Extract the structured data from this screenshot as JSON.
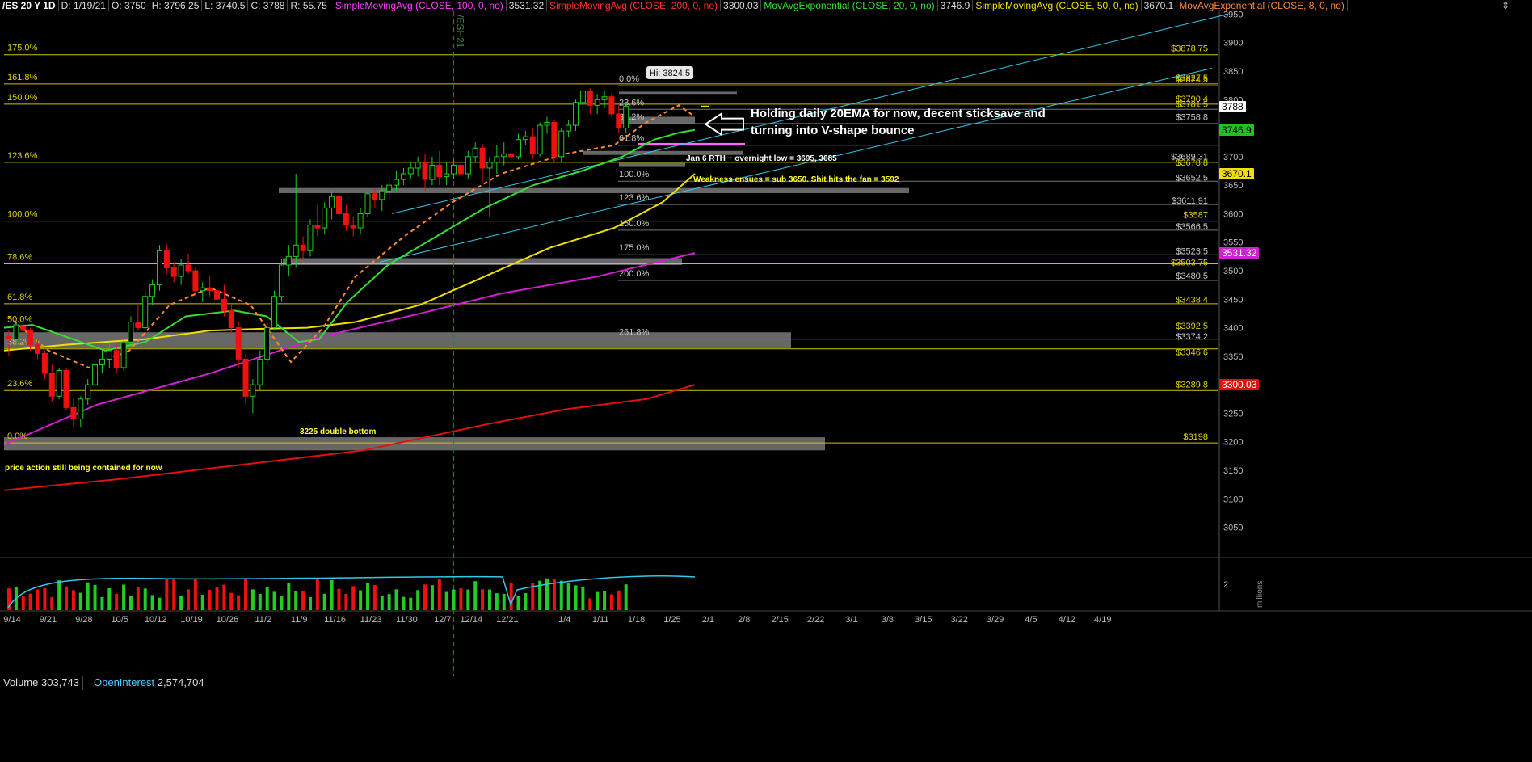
{
  "header": {
    "symbol": "/ES 20 Y 1D",
    "date": "D: 1/19/21",
    "open": "O: 3750",
    "high": "H: 3796.25",
    "low": "L: 3740.5",
    "close": "C: 3788",
    "range": "R: 55.75",
    "studies": [
      {
        "label": "SimpleMovingAvg (CLOSE, 100, 0, no)",
        "value": "3531.32",
        "color": "#ff3cff"
      },
      {
        "label": "SimpleMovingAvg (CLOSE, 200, 0, no)",
        "value": "3300.03",
        "color": "#ff3030"
      },
      {
        "label": "MovAvgExponential (CLOSE, 20, 0, no)",
        "value": "3746.9",
        "color": "#33e033"
      },
      {
        "label": "SimpleMovingAvg (CLOSE, 50, 0, no)",
        "value": "3670.1",
        "color": "#f0e000"
      },
      {
        "label": "MovAvgExponential (CLOSE, 8, 0, no)",
        "value": "",
        "color": "#ff8833"
      }
    ]
  },
  "chart_data": {
    "type": "candlestick",
    "price_axis": {
      "min": 3000,
      "max": 3950,
      "ticks": [
        3050,
        3100,
        3150,
        3200,
        3250,
        3300,
        3350,
        3400,
        3450,
        3500,
        3550,
        3600,
        3650,
        3700,
        3750,
        3800,
        3850,
        3900,
        3950
      ]
    },
    "date_labels": [
      "9/14",
      "9/21",
      "9/28",
      "10/5",
      "10/12",
      "10/19",
      "10/26",
      "11/2",
      "11/9",
      "11/16",
      "11/23",
      "11/30",
      "12/7",
      "12/14",
      "12/21",
      "1/4",
      "1/11",
      "1/18",
      "1/25",
      "2/1",
      "2/8",
      "2/15",
      "2/22",
      "3/1",
      "3/8",
      "3/15",
      "3/22",
      "3/29",
      "4/5",
      "4/12",
      "4/19"
    ],
    "date_label_index": [
      0,
      5,
      10,
      15,
      20,
      25,
      30,
      35,
      40,
      45,
      50,
      55,
      60,
      64,
      69,
      77,
      82,
      87,
      92,
      97,
      102,
      107,
      112,
      117,
      122,
      127,
      132,
      137,
      142,
      147,
      152
    ],
    "expiry_marker": {
      "label": "/ESH21",
      "index": 62
    },
    "ohlc": [
      [
        3385,
        3395,
        3350,
        3380
      ],
      [
        3380,
        3410,
        3370,
        3405
      ],
      [
        3402,
        3415,
        3390,
        3395
      ],
      [
        3395,
        3400,
        3360,
        3370
      ],
      [
        3370,
        3380,
        3345,
        3355
      ],
      [
        3355,
        3360,
        3310,
        3320
      ],
      [
        3320,
        3335,
        3270,
        3280
      ],
      [
        3280,
        3330,
        3275,
        3325
      ],
      [
        3325,
        3330,
        3255,
        3260
      ],
      [
        3260,
        3275,
        3225,
        3240
      ],
      [
        3240,
        3280,
        3225,
        3275
      ],
      [
        3275,
        3310,
        3265,
        3300
      ],
      [
        3300,
        3340,
        3290,
        3335
      ],
      [
        3335,
        3360,
        3320,
        3345
      ],
      [
        3345,
        3375,
        3330,
        3360
      ],
      [
        3360,
        3370,
        3320,
        3330
      ],
      [
        3330,
        3380,
        3325,
        3375
      ],
      [
        3375,
        3420,
        3365,
        3410
      ],
      [
        3410,
        3440,
        3395,
        3400
      ],
      [
        3400,
        3465,
        3395,
        3455
      ],
      [
        3455,
        3485,
        3440,
        3475
      ],
      [
        3475,
        3545,
        3465,
        3535
      ],
      [
        3535,
        3545,
        3495,
        3505
      ],
      [
        3505,
        3515,
        3480,
        3490
      ],
      [
        3490,
        3520,
        3475,
        3510
      ],
      [
        3510,
        3530,
        3495,
        3500
      ],
      [
        3500,
        3505,
        3455,
        3465
      ],
      [
        3465,
        3480,
        3445,
        3470
      ],
      [
        3470,
        3490,
        3455,
        3465
      ],
      [
        3465,
        3480,
        3440,
        3450
      ],
      [
        3450,
        3475,
        3420,
        3430
      ],
      [
        3430,
        3440,
        3390,
        3400
      ],
      [
        3400,
        3410,
        3330,
        3345
      ],
      [
        3345,
        3355,
        3265,
        3280
      ],
      [
        3280,
        3310,
        3250,
        3300
      ],
      [
        3300,
        3360,
        3290,
        3345
      ],
      [
        3345,
        3410,
        3335,
        3400
      ],
      [
        3400,
        3465,
        3395,
        3455
      ],
      [
        3455,
        3520,
        3445,
        3510
      ],
      [
        3510,
        3545,
        3490,
        3525
      ],
      [
        3525,
        3670,
        3505,
        3545
      ],
      [
        3545,
        3560,
        3520,
        3535
      ],
      [
        3535,
        3590,
        3525,
        3580
      ],
      [
        3580,
        3615,
        3560,
        3575
      ],
      [
        3575,
        3620,
        3565,
        3610
      ],
      [
        3610,
        3640,
        3590,
        3630
      ],
      [
        3630,
        3640,
        3590,
        3600
      ],
      [
        3600,
        3615,
        3570,
        3580
      ],
      [
        3580,
        3595,
        3560,
        3575
      ],
      [
        3575,
        3610,
        3565,
        3600
      ],
      [
        3600,
        3640,
        3595,
        3635
      ],
      [
        3635,
        3645,
        3610,
        3625
      ],
      [
        3625,
        3650,
        3605,
        3640
      ],
      [
        3640,
        3665,
        3625,
        3650
      ],
      [
        3650,
        3675,
        3640,
        3660
      ],
      [
        3660,
        3680,
        3650,
        3670
      ],
      [
        3670,
        3690,
        3660,
        3680
      ],
      [
        3680,
        3700,
        3665,
        3690
      ],
      [
        3690,
        3705,
        3640,
        3660
      ],
      [
        3660,
        3700,
        3650,
        3685
      ],
      [
        3685,
        3710,
        3650,
        3665
      ],
      [
        3665,
        3690,
        3650,
        3670
      ],
      [
        3670,
        3695,
        3660,
        3685
      ],
      [
        3685,
        3700,
        3660,
        3670
      ],
      [
        3670,
        3710,
        3660,
        3700
      ],
      [
        3700,
        3725,
        3690,
        3715
      ],
      [
        3715,
        3722,
        3655,
        3680
      ],
      [
        3680,
        3700,
        3595,
        3690
      ],
      [
        3690,
        3720,
        3670,
        3700
      ],
      [
        3700,
        3725,
        3685,
        3705
      ],
      [
        3705,
        3725,
        3690,
        3700
      ],
      [
        3700,
        3740,
        3695,
        3730
      ],
      [
        3730,
        3745,
        3720,
        3735
      ],
      [
        3735,
        3750,
        3695,
        3705
      ],
      [
        3705,
        3760,
        3700,
        3755
      ],
      [
        3755,
        3770,
        3740,
        3760
      ],
      [
        3760,
        3765,
        3690,
        3700
      ],
      [
        3700,
        3750,
        3690,
        3745
      ],
      [
        3745,
        3765,
        3735,
        3755
      ],
      [
        3755,
        3800,
        3745,
        3795
      ],
      [
        3795,
        3824.5,
        3780,
        3815
      ],
      [
        3815,
        3820,
        3775,
        3790
      ],
      [
        3790,
        3810,
        3775,
        3800
      ],
      [
        3800,
        3815,
        3785,
        3805
      ],
      [
        3805,
        3810,
        3770,
        3775
      ],
      [
        3775,
        3790,
        3740,
        3750
      ],
      [
        3750,
        3796.25,
        3740.5,
        3788
      ]
    ],
    "annotations": [
      {
        "text": "Holding daily 20EMA for now, decent sticksave and",
        "color": "#ffffff",
        "size": "large"
      },
      {
        "text": "turning into V-shape bounce",
        "color": "#ffffff",
        "size": "large"
      },
      {
        "text": "Jan 6  RTH + overnight low = 3695, 3685",
        "color": "#ffffff",
        "size": "small"
      },
      {
        "text": "Weakness ensues = sub 3650. Shit hits the fan = 3592",
        "color": "#ffff33",
        "size": "small"
      },
      {
        "text": "3225 double bottom",
        "color": "#ffff33",
        "size": "small"
      },
      {
        "text": "price action still being contained for now",
        "color": "#ffff33",
        "size": "small"
      }
    ],
    "high_marker": {
      "text": "Hi: 3824.5",
      "price": 3824.5
    },
    "left_fib_labels": [
      "175.0%",
      "161.8%",
      "150.0%",
      "123.6%",
      "100.0%",
      "78.6%",
      "61.8%",
      "50.0%",
      "38.2%",
      "23.6%",
      "0.0%"
    ],
    "left_fib_prices": [
      3878.75,
      3827.5,
      3792,
      3690,
      3587,
      3512,
      3442,
      3403,
      3363,
      3290,
      3198
    ],
    "inner_fib_labels": [
      "0.0%",
      "23.6%",
      "38.2%",
      "61.8%",
      "100.0%",
      "123.6%",
      "150.0%",
      "175.0%",
      "200.0%",
      "261.8%"
    ],
    "inner_fib_prices": [
      3824.5,
      3783,
      3758,
      3720,
      3657,
      3616,
      3571,
      3528,
      3483,
      3380
    ],
    "level_labels": [
      "$3878.75",
      "$3827.5",
      "$3824.5",
      "$3790.4",
      "$3781.5",
      "$3758.8",
      "$3689.31",
      "$3678.8",
      "$3652.5",
      "$3611.91",
      "$3587",
      "$3566.5",
      "$3523.5",
      "$3503.75",
      "$3480.5",
      "$3438.4",
      "$3392.5",
      "$3374.2",
      "$3346.6",
      "$3289.8",
      "$3198"
    ],
    "level_prices": [
      3878.75,
      3827.5,
      3824.5,
      3790.4,
      3781.5,
      3758.8,
      3689.31,
      3678.8,
      3652.5,
      3611.91,
      3587,
      3566.5,
      3523.5,
      3503.75,
      3480.5,
      3438.4,
      3392.5,
      3374.2,
      3346.6,
      3289.8,
      3198
    ],
    "price_tags": [
      {
        "text": "3788",
        "price": 3788,
        "bg": "#ffffff",
        "fg": "#000000"
      },
      {
        "text": "3746.9",
        "price": 3746.9,
        "bg": "#22c022",
        "fg": "#000000"
      },
      {
        "text": "3670.1",
        "price": 3670.1,
        "bg": "#f0e000",
        "fg": "#000000"
      },
      {
        "text": "3531.32",
        "price": 3531.32,
        "bg": "#d020d0",
        "fg": "#ffffff"
      },
      {
        "text": "3300.03",
        "price": 3300.03,
        "bg": "#e01010",
        "fg": "#ffffff"
      }
    ]
  },
  "volume_pane": {
    "volume_label": "Volume",
    "volume_value": "303,743",
    "oi_label": "OpenInterest",
    "oi_value": "2,574,704",
    "axis_label": "2",
    "unit_label": "millions"
  }
}
